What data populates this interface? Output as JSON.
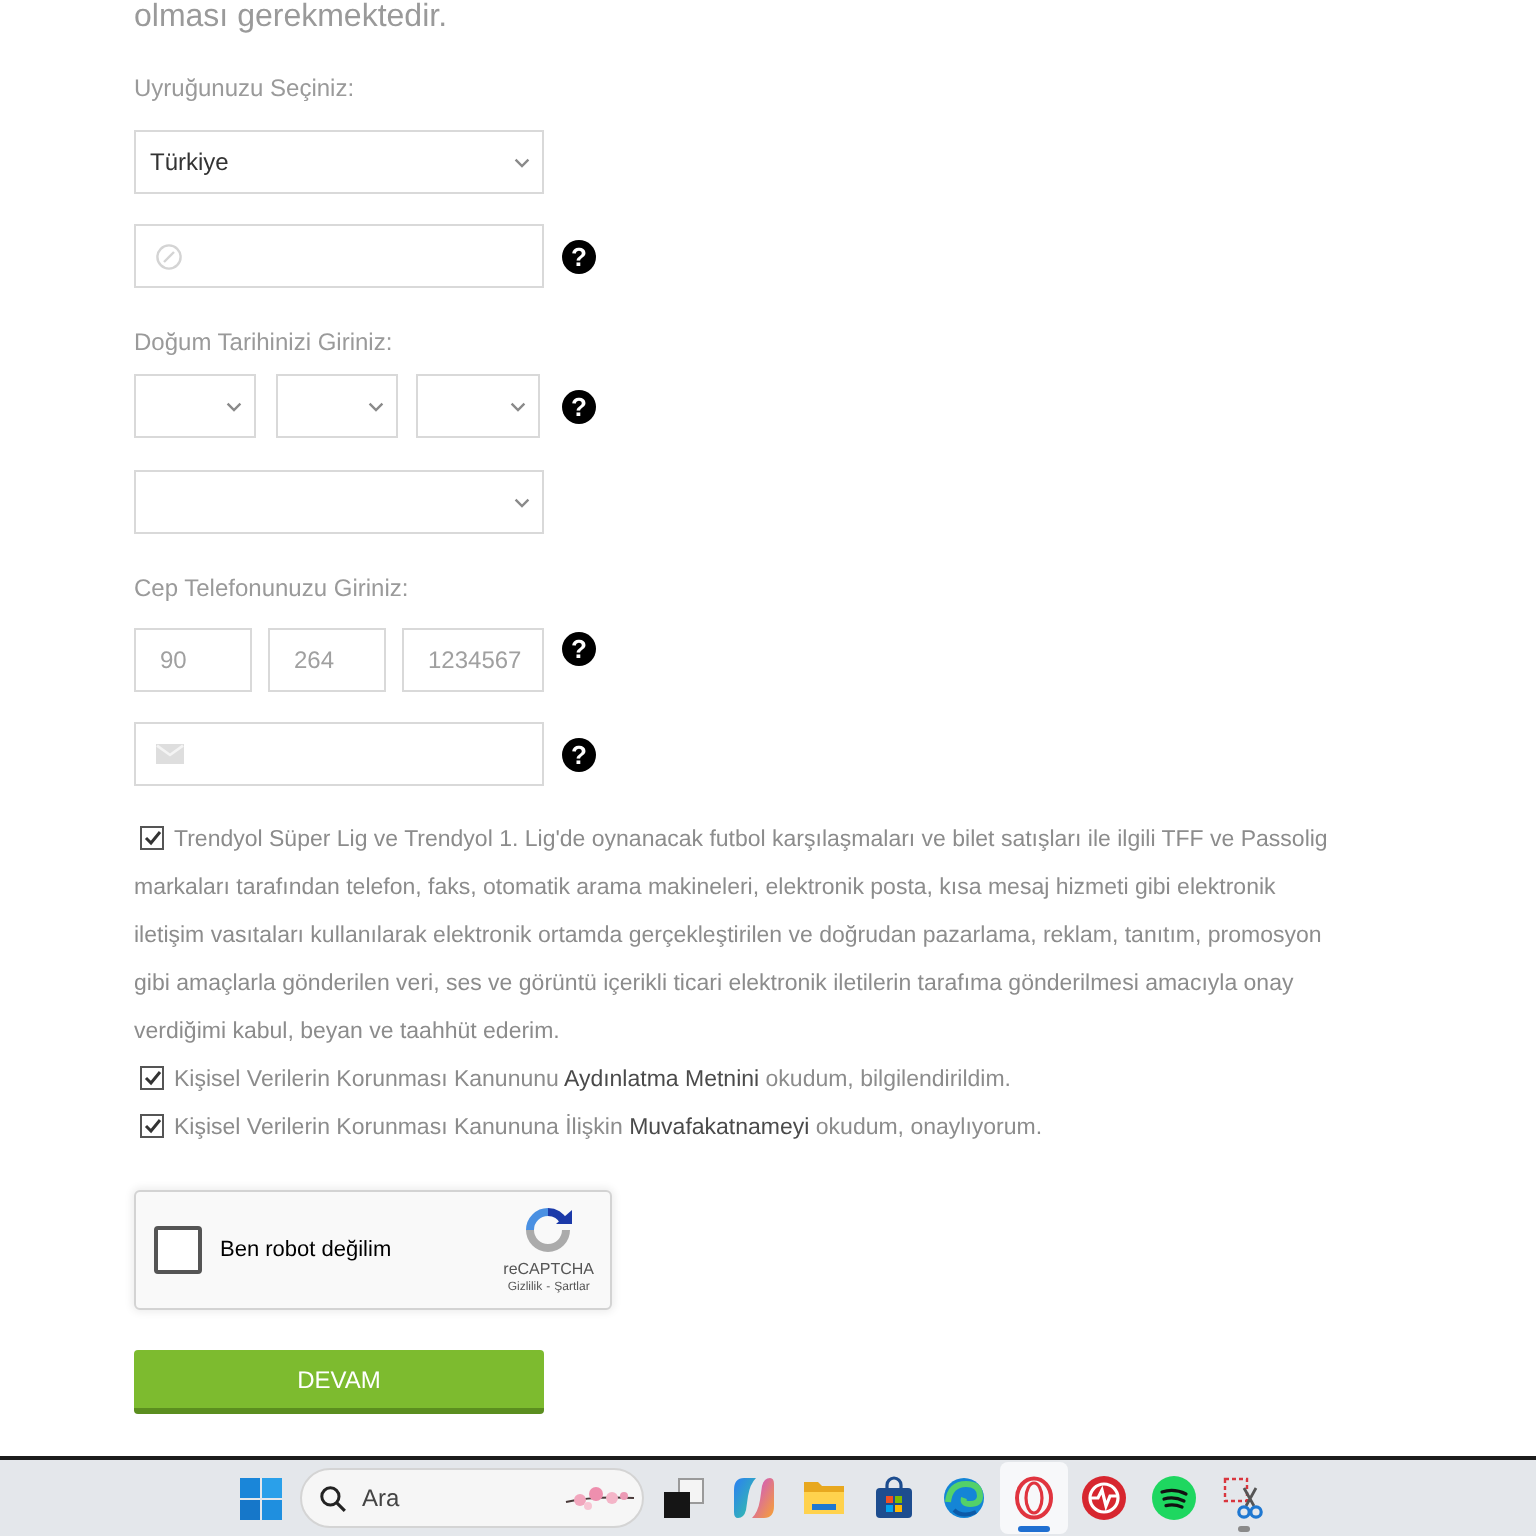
{
  "intro": "olması gerekmektedir.",
  "nationality": {
    "label": "Uyruğunuzu Seçiniz:",
    "value": "Türkiye"
  },
  "icon_field": {
    "help": "?"
  },
  "birth_date": {
    "label": "Doğum Tarihinizi Giriniz:",
    "help": "?"
  },
  "phone": {
    "label": "Cep Telefonunuzu Giriniz:",
    "fields": [
      {
        "placeholder": "90"
      },
      {
        "placeholder": "264"
      },
      {
        "placeholder": "1234567"
      }
    ],
    "help": "?"
  },
  "email_field": {
    "help": "?"
  },
  "consents": [
    {
      "checked": true,
      "text": "Trendyol Süper Lig ve Trendyol 1. Lig'de oynanacak futbol karşılaşmaları ve bilet satışları ile ilgili TFF ve Passolig markaları tarafından telefon, faks, otomatik arama makineleri, elektronik posta, kısa mesaj hizmeti gibi elektronik iletişim vasıtaları kullanılarak elektronik ortamda gerçekleştirilen ve doğrudan pazarlama, reklam, tanıtım, promosyon gibi amaçlarla gönderilen veri, ses ve görüntü içerikli ticari elektronik iletilerin tarafıma gönderilmesi amacıyla onay verdiğimi kabul, beyan ve taahhüt ederim."
    },
    {
      "checked": true,
      "text": "Kişisel Verilerin Korunması Kanununu",
      "link": "Aydınlatma Metnini",
      "after": "okudum, bilgilendirildim."
    },
    {
      "checked": true,
      "text": "Kişisel Verilerin Korunması Kanununa İlişkin",
      "link": "Muvafakatnameyi",
      "after": "okudum, onaylıyorum."
    }
  ],
  "captcha": {
    "checked": false,
    "label": "Ben robot değilim",
    "brand": "reCAPTCHA",
    "links": [
      "Gizlilik",
      "Şartlar"
    ],
    "separator": "-"
  },
  "submit": "DEVAM",
  "taskbar": {
    "search": {
      "placeholder": "Ara"
    },
    "apps": [
      {
        "kind": "squares",
        "selected": false,
        "running": false
      },
      {
        "kind": "swirl",
        "selected": false,
        "running": false
      },
      {
        "kind": "folder",
        "selected": false,
        "running": false
      },
      {
        "kind": "bag",
        "selected": false,
        "running": false
      },
      {
        "kind": "globe",
        "selected": false,
        "running": false
      },
      {
        "kind": "ring",
        "selected": true,
        "running": true
      },
      {
        "kind": "pulse",
        "selected": false,
        "running": false
      },
      {
        "kind": "disc",
        "selected": false,
        "running": false
      },
      {
        "kind": "scissors",
        "selected": false,
        "running": true
      }
    ]
  }
}
